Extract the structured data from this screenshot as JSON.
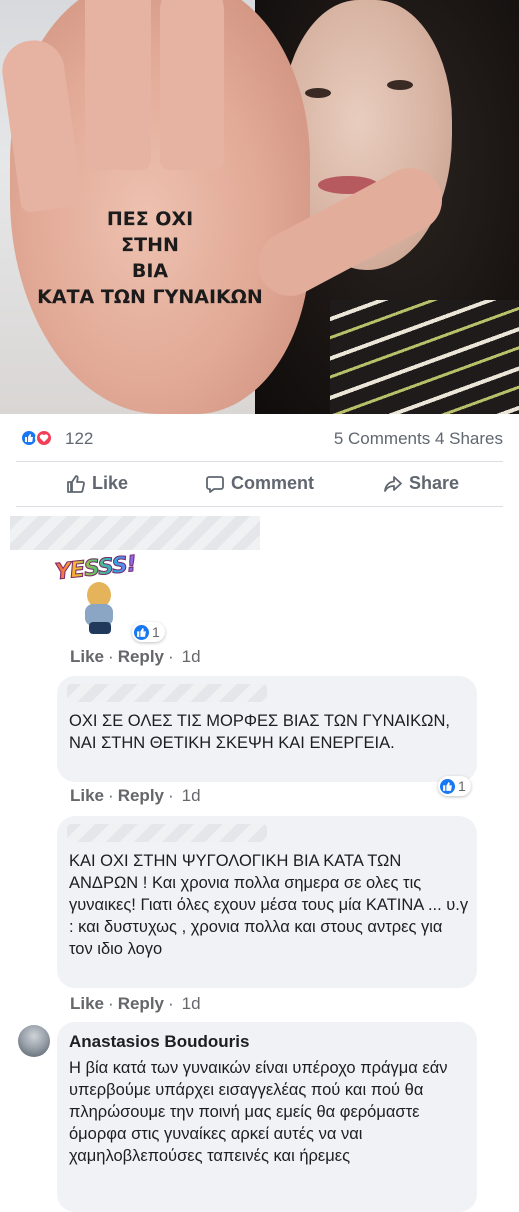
{
  "post": {
    "image_text": [
      "ΠΕΣ ΟΧΙ",
      "ΣΤΗΝ",
      "ΒΙΑ",
      "ΚΑΤΑ ΤΩΝ ΓΥΝΑΙΚΩΝ"
    ],
    "reaction_count": "122",
    "comments_count": "5 Comments",
    "shares_count": "4 Shares",
    "reaction_icons": [
      "like-icon",
      "love-icon"
    ]
  },
  "actions": {
    "like": "Like",
    "comment": "Comment",
    "share": "Share"
  },
  "comments": [
    {
      "sticker_text": "YESSS!",
      "reaction_badge": "1",
      "like": "Like",
      "reply": "Reply",
      "sep": "·",
      "time": "1d"
    },
    {
      "text": "ΟΧΙ ΣΕ ΟΛΕΣ ΤΙΣ ΜΟΡΦΕΣ ΒΙΑΣ ΤΩΝ ΓΥΝΑΙΚΩΝ, ΝΑΙ ΣΤΗΝ ΘΕΤΙΚΗ ΣΚΕΨΗ ΚΑΙ ΕΝΕΡΓΕΙΑ.",
      "reaction_badge": "1",
      "like": "Like",
      "reply": "Reply",
      "sep": "·",
      "time": "1d"
    },
    {
      "text": "ΚΑΙ ΟΧΙ ΣΤΗΝ ΨΥΓΟΛΟΓΙΚΗ ΒΙΑ ΚΑΤΑ ΤΩΝ ΑΝΔΡΩΝ ! Και χρονια πολλα σημερα σε ολες τις γυναικες! Γιατι όλες εχουν μέσα τους μία ΚΑΤΙΝΑ ... υ.γ : και δυστυχως , χρονια πολλα και στους αντρες για τον ιδιο λογο",
      "like": "Like",
      "reply": "Reply",
      "sep": "·",
      "time": "1d"
    },
    {
      "author": "Anastasios Boudouris",
      "text": "Η βία κατά των γυναικών είναι υπέροχο πράγμα εάν υπερβούμε υπάρχει εισαγγελέας πού και πού θα πληρώσουμε την ποινή μας εμείς θα φερόμαστε όμορφα στις γυναίκες αρκεί αυτές να ναι χαμηλοβλεπούσες ταπεινές και ήρεμες"
    }
  ],
  "colors": {
    "like_blue": "#1877f2",
    "love_red": "#f33e58",
    "bubble_bg": "#f0f2f5",
    "muted_text": "#65676b"
  }
}
